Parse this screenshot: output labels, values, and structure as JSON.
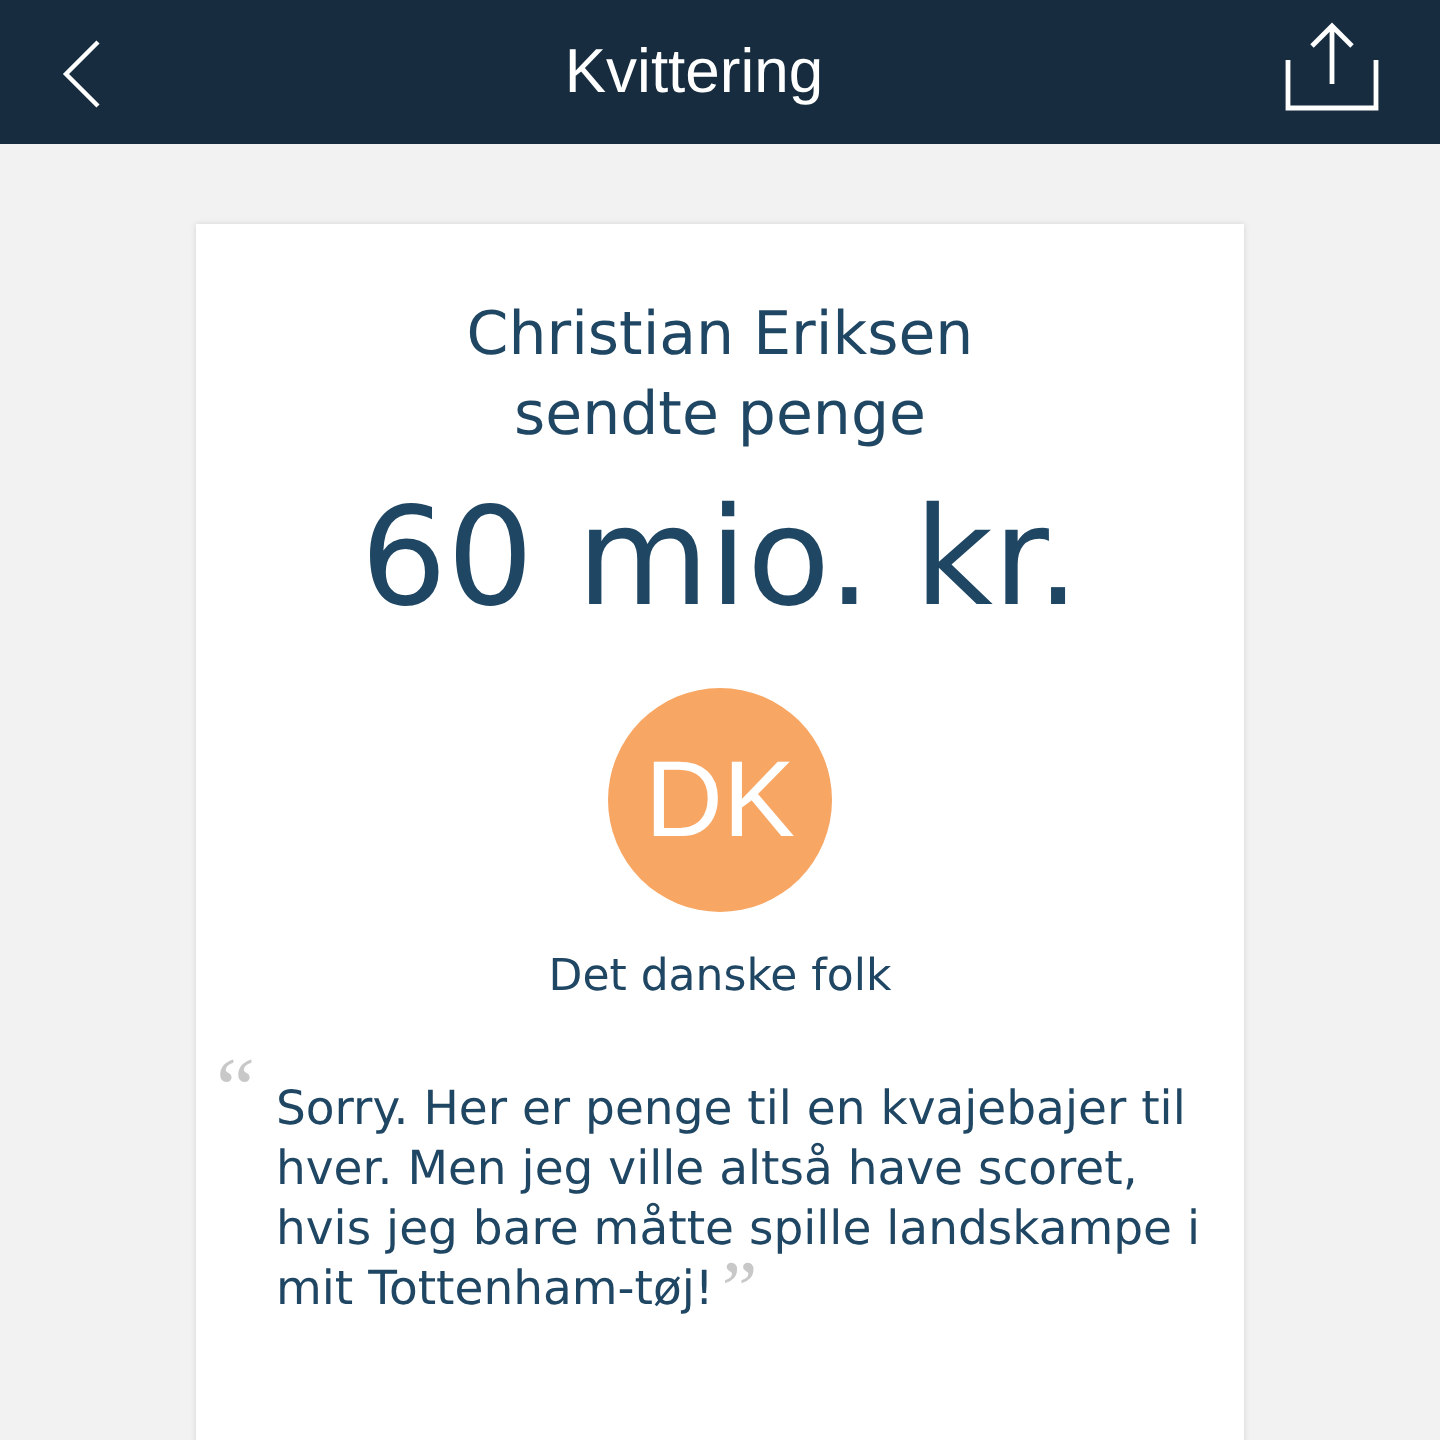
{
  "header": {
    "title": "Kvittering"
  },
  "receipt": {
    "sender": "Christian Eriksen",
    "action": "sendte penge",
    "amount": "60 mio. kr.",
    "recipient": {
      "initials": "DK",
      "color": "#f7a663",
      "name": "Det danske folk"
    },
    "message": {
      "open_quote": "“",
      "text": "Sorry. Her er penge til en kvajebajer til hver. Men jeg ville altså have scoret, hvis jeg bare måtte spille landskampe i mit Tottenham-tøj!",
      "close_quote": "”"
    }
  }
}
